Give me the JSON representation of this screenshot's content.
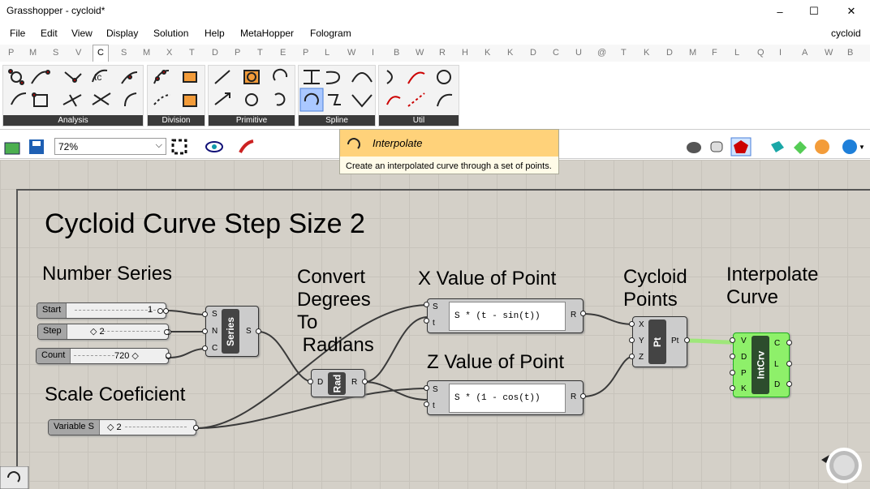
{
  "window": {
    "title": "Grasshopper - cycloid*",
    "file_name": "cycloid",
    "min": "–",
    "max": "☐",
    "close": "✕"
  },
  "menu": [
    "File",
    "Edit",
    "View",
    "Display",
    "Solution",
    "Help",
    "MetaHopper",
    "Fologram"
  ],
  "tabs": [
    "P",
    "M",
    "S",
    "V",
    "C",
    "S",
    "M",
    "X",
    "T",
    "D",
    "P",
    "T",
    "E",
    "P",
    "L",
    "W",
    "I",
    "B",
    "W",
    "R",
    "H",
    "K",
    "K",
    "D",
    "C",
    "U",
    "@",
    "T",
    "K",
    "D",
    "M",
    "F",
    "L",
    "Q",
    "I",
    "A",
    "W",
    "B"
  ],
  "active_tab": "C",
  "ribbon_groups": [
    "Analysis",
    "Division",
    "Primitive",
    "Spline",
    "Util"
  ],
  "toolbar": {
    "zoom": "72%"
  },
  "tooltip": {
    "name": "Interpolate",
    "description": "Create an interpolated curve through a set of points."
  },
  "canvas": {
    "title": "Cycloid Curve Step Size 2",
    "labels": {
      "series": "Number Series",
      "scale": "Scale Coeficient",
      "convert1": "Convert",
      "convert2": "Degrees",
      "convert3": "To",
      "convert4": " Radians",
      "xval": "X Value of Point",
      "zval": "Z Value of Point",
      "cyc1": "Cycloid",
      "cyc2": "Points",
      "int1": "Interpolate",
      "int2": "Curve"
    },
    "sliders": {
      "start": {
        "label": "Start",
        "value": "1"
      },
      "step": {
        "label": "Step",
        "value": "◇ 2"
      },
      "count": {
        "label": "Count",
        "value": "720 ◇"
      },
      "scale": {
        "label": "Variable S",
        "value": "◇ 2"
      }
    },
    "series_comp": {
      "name": "Series",
      "inputs": [
        "S",
        "N",
        "C"
      ],
      "output": "S"
    },
    "rad_comp": {
      "name": "Rad",
      "input": "D",
      "output": "R"
    },
    "x_expr": {
      "inputs": [
        "S",
        "t"
      ],
      "expr": "S * (t - sin(t))",
      "output": "R"
    },
    "z_expr": {
      "inputs": [
        "S",
        "t"
      ],
      "expr": "S * (1 - cos(t))",
      "output": "R"
    },
    "pt_comp": {
      "name": "Pt",
      "inputs": [
        "X",
        "Y",
        "Z"
      ],
      "output": "Pt"
    },
    "int_comp": {
      "name": "IntCrv",
      "inputs": [
        "V",
        "D",
        "P",
        "K"
      ],
      "outputs": [
        "C",
        "L",
        "D"
      ]
    }
  }
}
